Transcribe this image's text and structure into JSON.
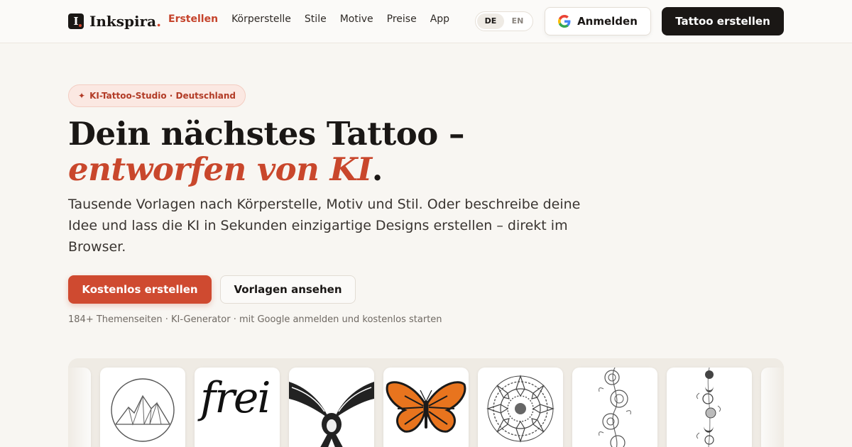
{
  "brand": {
    "name": "Inkspira",
    "logo_letter": "I"
  },
  "nav": [
    "Erstellen",
    "Körperstelle",
    "Stile",
    "Motive",
    "Preise",
    "App"
  ],
  "lang": {
    "de": "DE",
    "en": "EN"
  },
  "header": {
    "login": "Anmelden",
    "create": "Tattoo erstellen"
  },
  "hero": {
    "badge_icon": "✦",
    "badge": "KI-Tattoo-Studio · Deutschland",
    "title_line1": "Dein nächstes Tattoo –",
    "title_line2_em": "entworfen von KI",
    "title_line2_end": ".",
    "lead": "Tausende Vorlagen nach Körperstelle, Motiv und Stil. Oder beschreibe deine Idee und lass die KI in Sekunden einzigartige Designs erstellen – direkt im Browser.",
    "cta_primary": "Kostenlos erstellen",
    "cta_secondary": "Vorlagen ansehen",
    "note": "184+ Themenseiten · KI-Generator · mit Google anmelden und kostenlos starten"
  },
  "gallery": {
    "fine_line_word": "frei",
    "icons": [
      "mountain-circle",
      "script-word",
      "swallow",
      "monarch-butterfly",
      "mandala",
      "floral-vine",
      "moon-phases-vine",
      "partial-card"
    ]
  },
  "colors": {
    "accent": "#cf4a30",
    "dark": "#1a1715",
    "background": "#f8f6f2"
  }
}
